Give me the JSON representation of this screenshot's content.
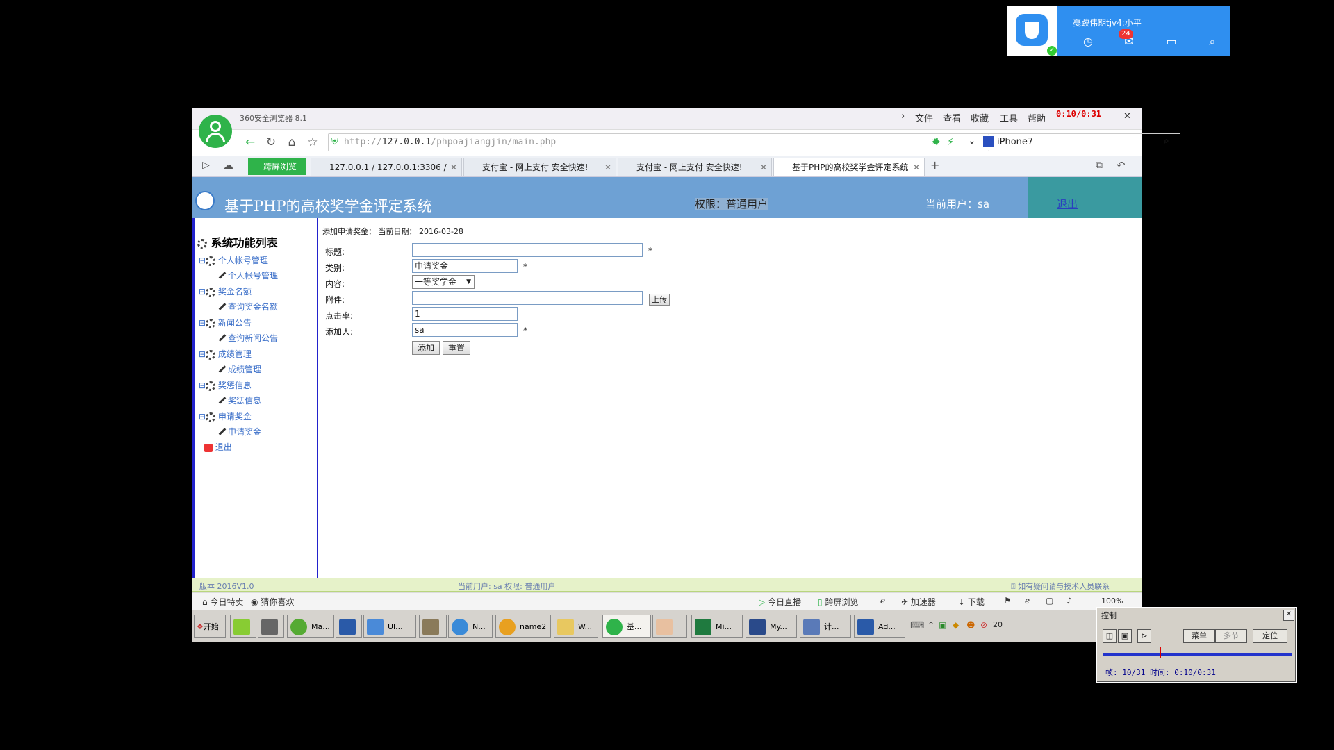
{
  "notification": {
    "user": "戞跛伟期tjv4:小平",
    "badge": "24"
  },
  "browser": {
    "app_title": "360安全浏览器 8.1",
    "menus": [
      "文件",
      "查看",
      "收藏",
      "工具",
      "帮助"
    ],
    "timer": "0:10/0:31",
    "url_prefix": "http://",
    "url_host": "127.0.0.1",
    "url_path": "/phpoajiangjin/main.php",
    "search_value": "iPhone7",
    "split_view": "跨屏浏览",
    "tabs": [
      {
        "label": "127.0.0.1 / 127.0.0.1:3306 / "
      },
      {
        "label": "支付宝 - 网上支付 安全快速!"
      },
      {
        "label": "支付宝 - 网上支付 安全快速!"
      },
      {
        "label": "基于PHP的高校奖学金评定系统"
      }
    ]
  },
  "page": {
    "system_title": "基于PHP的高校奖学金评定系统",
    "permission": "权限：普通用户",
    "current_user": "当前用户：sa",
    "logout": "退出",
    "sidebar": {
      "heading": "系统功能列表",
      "groups": [
        {
          "label": "个人帐号管理",
          "child": "个人帐号管理"
        },
        {
          "label": "奖金名额",
          "child": "查询奖金名额"
        },
        {
          "label": "新闻公告",
          "child": "查询新闻公告"
        },
        {
          "label": "成绩管理",
          "child": "成绩管理"
        },
        {
          "label": "奖惩信息",
          "child": "奖惩信息"
        },
        {
          "label": "申请奖金",
          "child": "申请奖金"
        }
      ],
      "exit": "退出"
    },
    "form": {
      "heading": "添加申请奖金：  当前日期：",
      "date": "2016-03-28",
      "title_label": "标题:",
      "title_value": "",
      "category_label": "类别:",
      "category_value": "申请奖金",
      "content_label": "内容:",
      "content_value": "一等奖学金",
      "attachment_label": "附件:",
      "upload": "上传",
      "clicks_label": "点击率:",
      "clicks_value": "1",
      "adder_label": "添加人:",
      "adder_value": "sa",
      "required": "*",
      "add": "添加",
      "reset": "重置"
    },
    "footer": {
      "version": "版本 2016V1.0",
      "user_info": "当前用户: sa 权限:  普通用户",
      "contact": "如有疑问请与技术人员联系"
    }
  },
  "statusbar": {
    "left": [
      "今日特卖",
      "猜你喜欢"
    ],
    "right": [
      "今日直播",
      "跨屏浏览",
      "加速器",
      "下载"
    ],
    "zoom": "100%"
  },
  "taskbar": {
    "start": "开始",
    "buttons": [
      "Ma...",
      "Ul...",
      "N...",
      "name2",
      "W...",
      "基...",
      "Mi...",
      "My...",
      "计...",
      "Ad..."
    ],
    "clock": "20"
  },
  "control": {
    "title": "控制",
    "menu": "菜单",
    "segment": "多节",
    "locate": "定位",
    "frame_info": "帧: 10/31 时间: 0:10/0:31"
  }
}
